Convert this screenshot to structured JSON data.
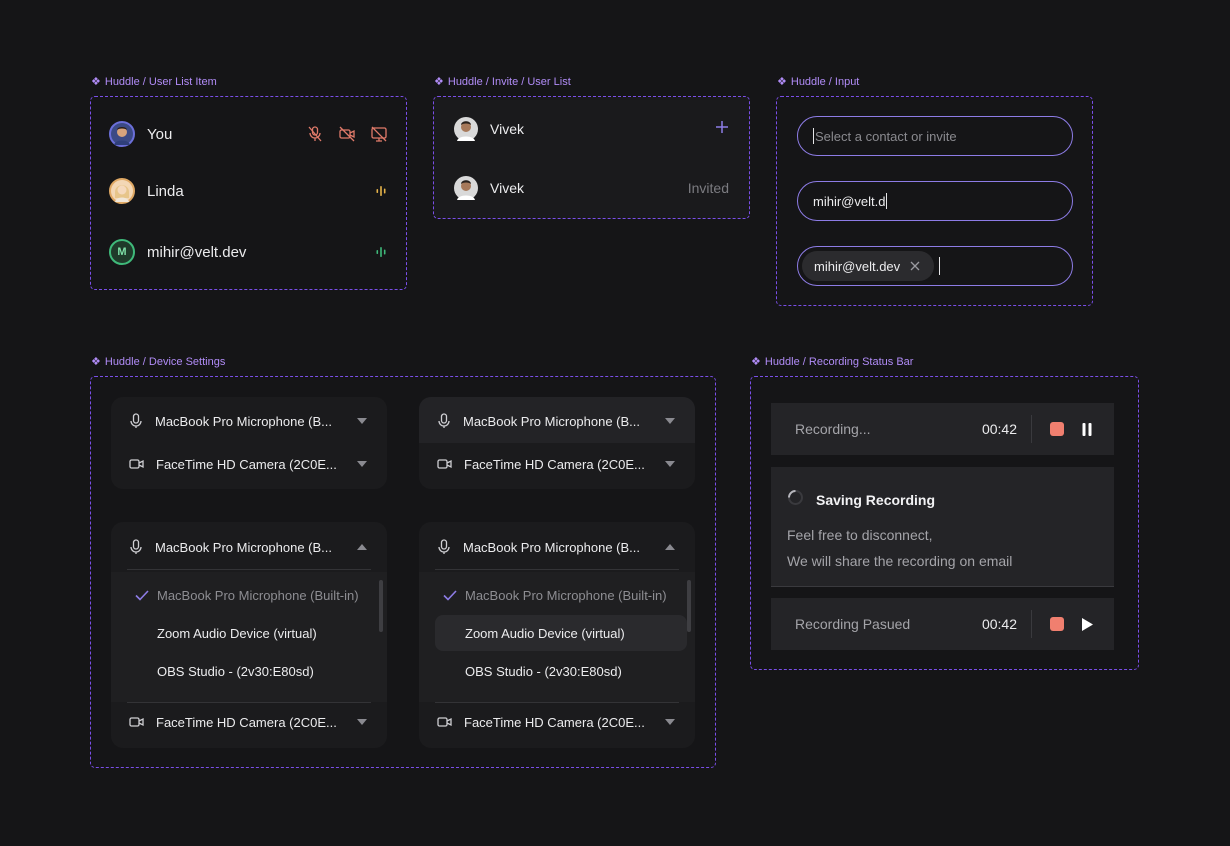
{
  "labels": {
    "user_list_item": "Huddle / User List Item",
    "invite_user_list": "Huddle / Invite / User List",
    "input": "Huddle / Input",
    "device_settings": "Huddle / Device Settings",
    "recording_status_bar": "Huddle / Recording Status Bar"
  },
  "label_glyph": "❖",
  "user_list": [
    {
      "name": "You",
      "avatar_icon": "user-photo-avatar"
    },
    {
      "name": "Linda",
      "avatar_icon": "user-photo-avatar"
    },
    {
      "name": "mihir@velt.dev",
      "avatar_initial": "M"
    }
  ],
  "invite_list": [
    {
      "name": "Vivek",
      "action_icon": "plus-icon"
    },
    {
      "name": "Vivek",
      "status": "Invited"
    }
  ],
  "inputs": {
    "placeholder": "Select a contact or invite",
    "typed_value": "mihir@velt.d",
    "chip_value": "mihir@velt.dev"
  },
  "device_settings": {
    "mic_label": "MacBook Pro Microphone (B...",
    "camera_label": "FaceTime HD Camera (2C0E...",
    "options": [
      "MacBook Pro Microphone (Built-in)",
      "Zoom Audio Device (virtual)",
      "OBS Studio - (2v30:E80sd)"
    ]
  },
  "recording": {
    "status_recording": "Recording...",
    "time": "00:42",
    "saving_title": "Saving Recording",
    "saving_line1": "Feel free to disconnect,",
    "saving_line2": "We will share the recording on email",
    "status_paused": "Recording Pasued",
    "time_paused": "00:42"
  },
  "colors": {
    "accent": "#7a4ee8",
    "stop": "#f07f6f",
    "linda_audio": "#e6b44a",
    "mihir_audio": "#3fb97a",
    "muted_icons": "#e07a6a"
  }
}
